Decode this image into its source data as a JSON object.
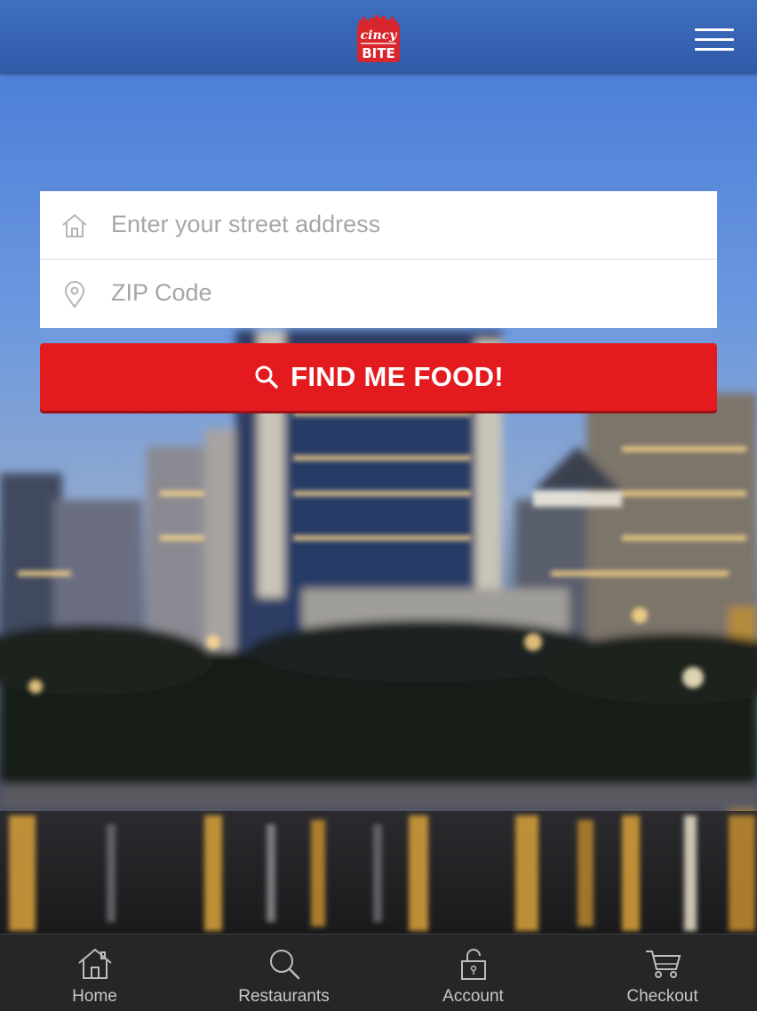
{
  "header": {
    "logo": {
      "top_text": "cincy",
      "bottom_text": "BITE",
      "brand_color": "#d8262c"
    },
    "menu_icon": "hamburger-menu-icon",
    "bar_color": "#3462b3"
  },
  "search": {
    "address_placeholder": "Enter your street address",
    "address_value": "",
    "address_icon": "house-icon",
    "zip_placeholder": "ZIP Code",
    "zip_value": "",
    "zip_icon": "map-pin-icon"
  },
  "find_button": {
    "label": "FIND ME FOOD!",
    "icon": "search-icon",
    "color": "#e31b1f"
  },
  "tabbar": {
    "items": [
      {
        "label": "Home",
        "icon": "home-icon"
      },
      {
        "label": "Restaurants",
        "icon": "search-icon"
      },
      {
        "label": "Account",
        "icon": "lock-icon"
      },
      {
        "label": "Checkout",
        "icon": "cart-icon"
      }
    ]
  }
}
